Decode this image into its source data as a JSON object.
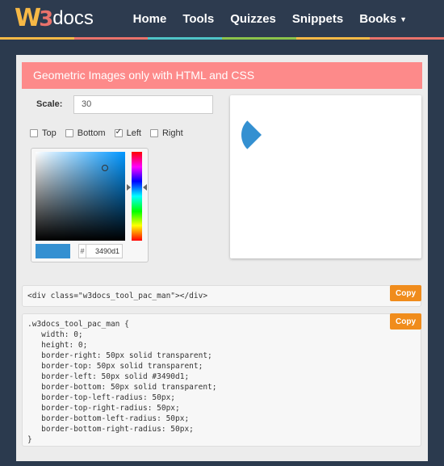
{
  "nav": {
    "logo_w": "W",
    "logo_3": "3",
    "logo_docs": "docs",
    "items": [
      {
        "label": "Home"
      },
      {
        "label": "Tools"
      },
      {
        "label": "Quizzes"
      },
      {
        "label": "Snippets"
      },
      {
        "label": "Books"
      }
    ],
    "stripe_colors": [
      "#f7b946",
      "#e9726b",
      "#4fc3c6",
      "#8bc34a",
      "#f7b946",
      "#e9726b"
    ]
  },
  "tool": {
    "title": "Geometric Images only with HTML and CSS",
    "scale_label": "Scale:",
    "scale_value": "30",
    "checkboxes": [
      {
        "label": "Top",
        "checked": false
      },
      {
        "label": "Bottom",
        "checked": false
      },
      {
        "label": "Left",
        "checked": true
      },
      {
        "label": "Right",
        "checked": false
      }
    ],
    "color": {
      "hash": "#",
      "hex": "3490d1",
      "value": "#3490d1"
    },
    "html_code": "<div class=\"w3docs_tool_pac_man\"></div>",
    "css_code": [
      ".w3docs_tool_pac_man {",
      "   width: 0;",
      "   height: 0;",
      "   border-right: 50px solid transparent;",
      "   border-top: 50px solid transparent;",
      "   border-left: 50px solid #3490d1;",
      "   border-bottom: 50px solid transparent;",
      "   border-top-left-radius: 50px;",
      "   border-top-right-radius: 50px;",
      "   border-bottom-left-radius: 50px;",
      "   border-bottom-right-radius: 50px;",
      "}"
    ],
    "copy_label": "Copy"
  }
}
